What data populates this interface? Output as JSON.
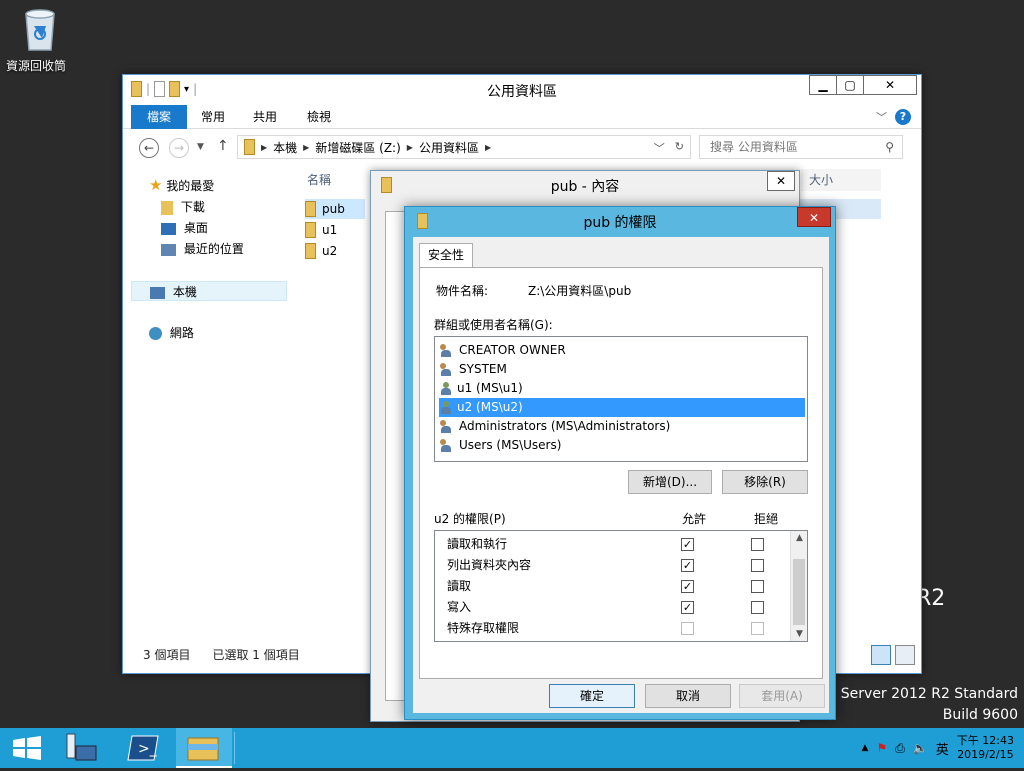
{
  "desktop": {
    "recycle_bin_label": "資源回收筒",
    "watermark_fragment": "R2",
    "watermark_line1": "Server 2012 R2 Standard",
    "watermark_line2": "Build 9600"
  },
  "explorer": {
    "title": "公用資料區",
    "minimize": "▁",
    "maximize": "▢",
    "close": "✕",
    "ribbon_tabs": [
      "檔案",
      "常用",
      "共用",
      "檢視"
    ],
    "help": "?",
    "address": [
      "本機",
      "新增磁碟區 (Z:)",
      "公用資料區"
    ],
    "search_placeholder": "搜尋 公用資料區",
    "nav": {
      "favorites": "我的最愛",
      "downloads": "下載",
      "desktop": "桌面",
      "recent": "最近的位置",
      "this_pc": "本機",
      "network": "網路"
    },
    "columns": {
      "name": "名稱",
      "size": "大小"
    },
    "files": [
      "pub",
      "u1",
      "u2"
    ],
    "status_items": "3 個項目",
    "status_selected": "已選取 1 個項目"
  },
  "props_dialog": {
    "title": "pub - 內容",
    "close": "✕"
  },
  "perm_dialog": {
    "title": "pub 的權限",
    "close": "✕",
    "tab": "安全性",
    "object_label": "物件名稱:",
    "object_value": "Z:\\公用資料區\\pub",
    "group_label": "群組或使用者名稱(G):",
    "users": [
      {
        "name": "CREATOR OWNER",
        "kind": "group"
      },
      {
        "name": "SYSTEM",
        "kind": "group"
      },
      {
        "name": "u1 (MS\\u1)",
        "kind": "user"
      },
      {
        "name": "u2 (MS\\u2)",
        "kind": "user"
      },
      {
        "name": "Administrators (MS\\Administrators)",
        "kind": "group"
      },
      {
        "name": "Users (MS\\Users)",
        "kind": "group"
      }
    ],
    "selected_user": 3,
    "add_button": "新增(D)...",
    "remove_button": "移除(R)",
    "perm_label": "u2 的權限(P)",
    "allow_header": "允許",
    "deny_header": "拒絕",
    "permissions": [
      {
        "name": "讀取和執行",
        "allow": true,
        "deny": false,
        "disabled": false
      },
      {
        "name": "列出資料夾內容",
        "allow": true,
        "deny": false,
        "disabled": false
      },
      {
        "name": "讀取",
        "allow": true,
        "deny": false,
        "disabled": false
      },
      {
        "name": "寫入",
        "allow": true,
        "deny": false,
        "disabled": false
      },
      {
        "name": "特殊存取權限",
        "allow": false,
        "deny": false,
        "disabled": true
      }
    ],
    "ok_button": "確定",
    "cancel_button": "取消",
    "apply_button": "套用(A)"
  },
  "taskbar": {
    "ime": "英",
    "time": "下午 12:43",
    "date": "2019/2/15"
  },
  "colors": {
    "taskbar": "#1f9ed6",
    "active_dialog_frame": "#5ab7e0",
    "selection": "#3399ff",
    "file_tab": "#1979ca",
    "close_red": "#c7392b"
  }
}
